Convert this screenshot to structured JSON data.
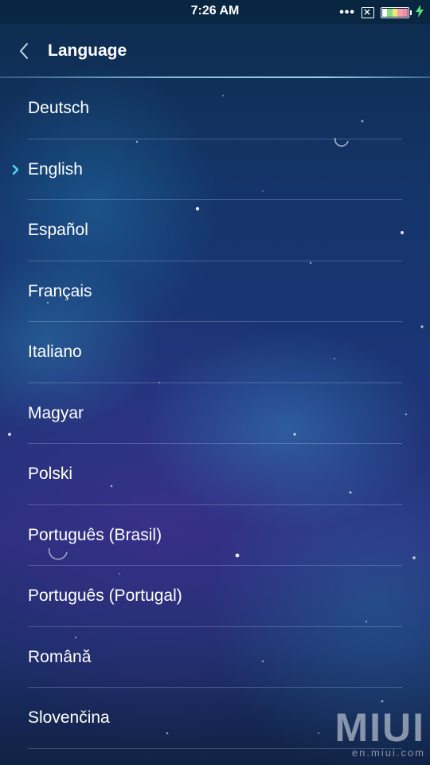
{
  "status_bar": {
    "time": "7:26 AM",
    "signal_dots": "•••",
    "sim_icon": "sim-x-icon",
    "battery_icon": "battery-icon",
    "charging_icon": "lightning-icon"
  },
  "header": {
    "back_icon": "chevron-left-icon",
    "title": "Language"
  },
  "languages": [
    {
      "label": "Deutsch",
      "selected": false
    },
    {
      "label": "English",
      "selected": true
    },
    {
      "label": "Español",
      "selected": false
    },
    {
      "label": "Français",
      "selected": false
    },
    {
      "label": "Italiano",
      "selected": false
    },
    {
      "label": "Magyar",
      "selected": false
    },
    {
      "label": "Polski",
      "selected": false
    },
    {
      "label": "Português (Brasil)",
      "selected": false
    },
    {
      "label": "Português (Portugal)",
      "selected": false
    },
    {
      "label": "Română",
      "selected": false
    },
    {
      "label": "Slovenčina",
      "selected": false
    }
  ],
  "watermark": {
    "logo": "MIUI",
    "url": "en.miui.com"
  },
  "colors": {
    "accent": "#4fd6e8",
    "text": "#ffffff",
    "charging": "#55e07a"
  }
}
